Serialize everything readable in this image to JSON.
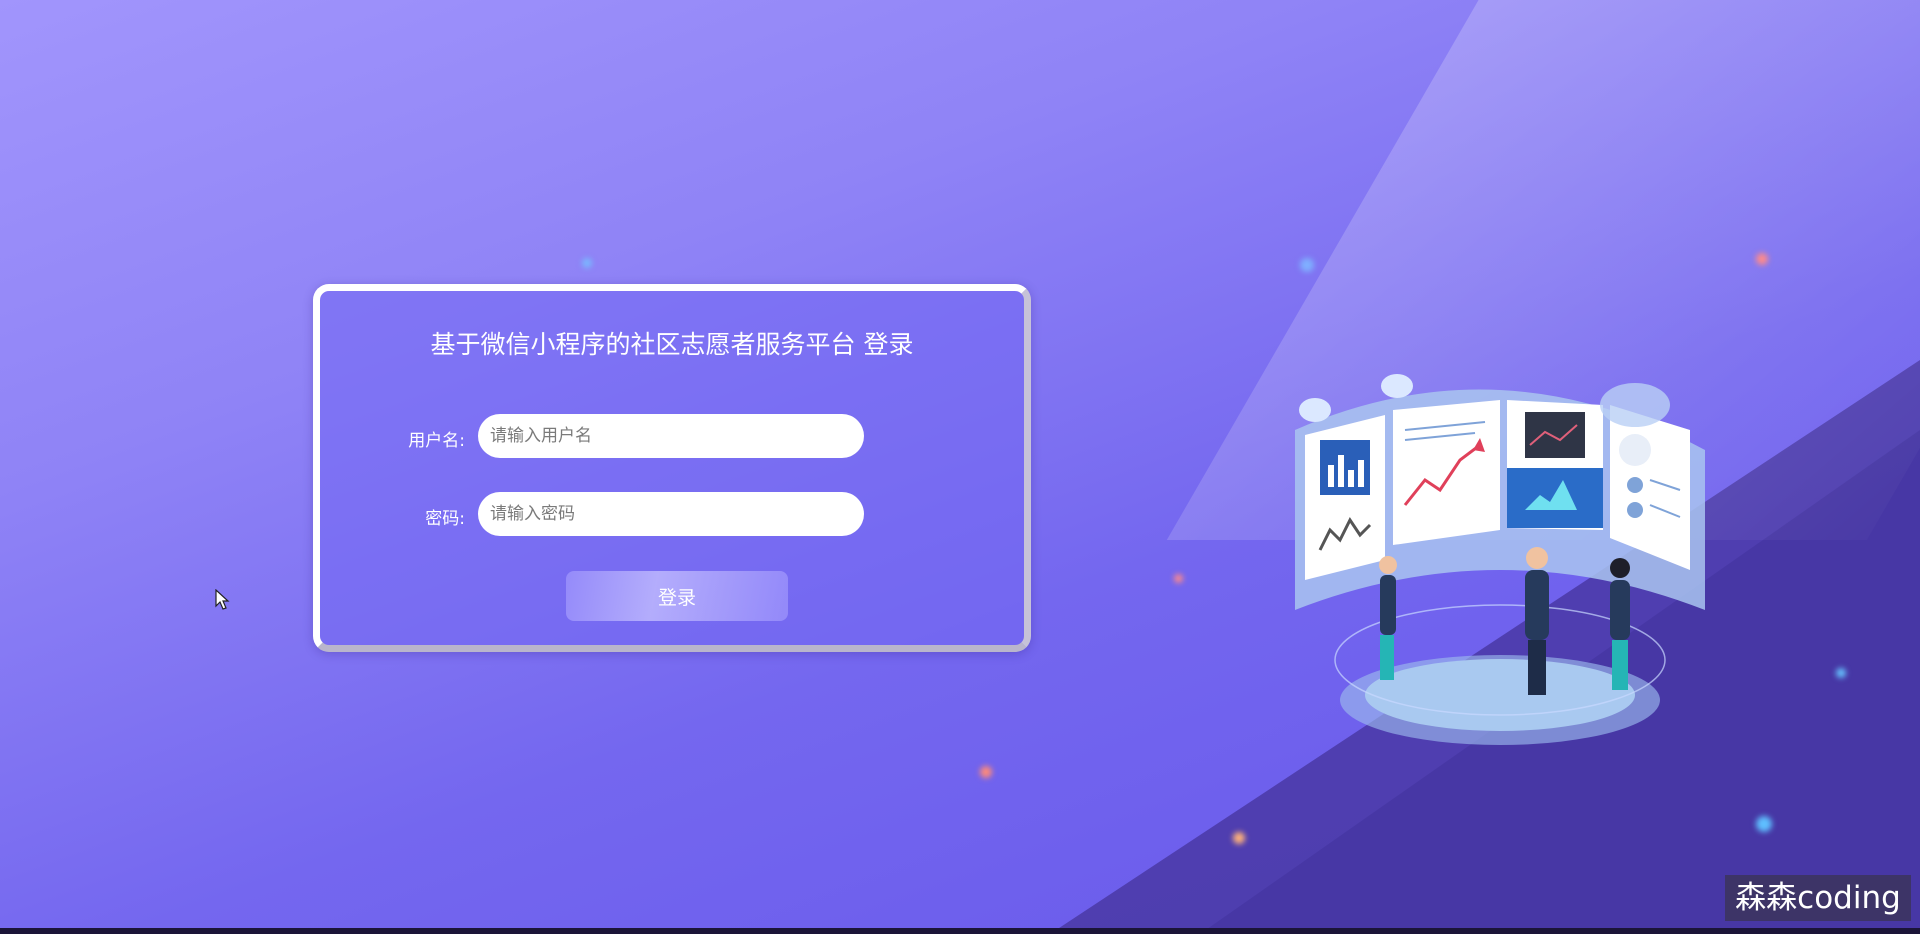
{
  "login": {
    "title": "基于微信小程序的社区志愿者服务平台 登录",
    "username_label": "用户名:",
    "username_placeholder": "请输入用户名",
    "password_label": "密码:",
    "password_placeholder": "请输入密码",
    "submit_label": "登录"
  },
  "watermark": "森森coding",
  "colors": {
    "background_top": "#a195fc",
    "background_bottom": "#6656ea",
    "dark_wedge": "#4a3aa8",
    "card_border": "#ffffff"
  },
  "illustration": {
    "name": "data-dashboard-illustration"
  }
}
